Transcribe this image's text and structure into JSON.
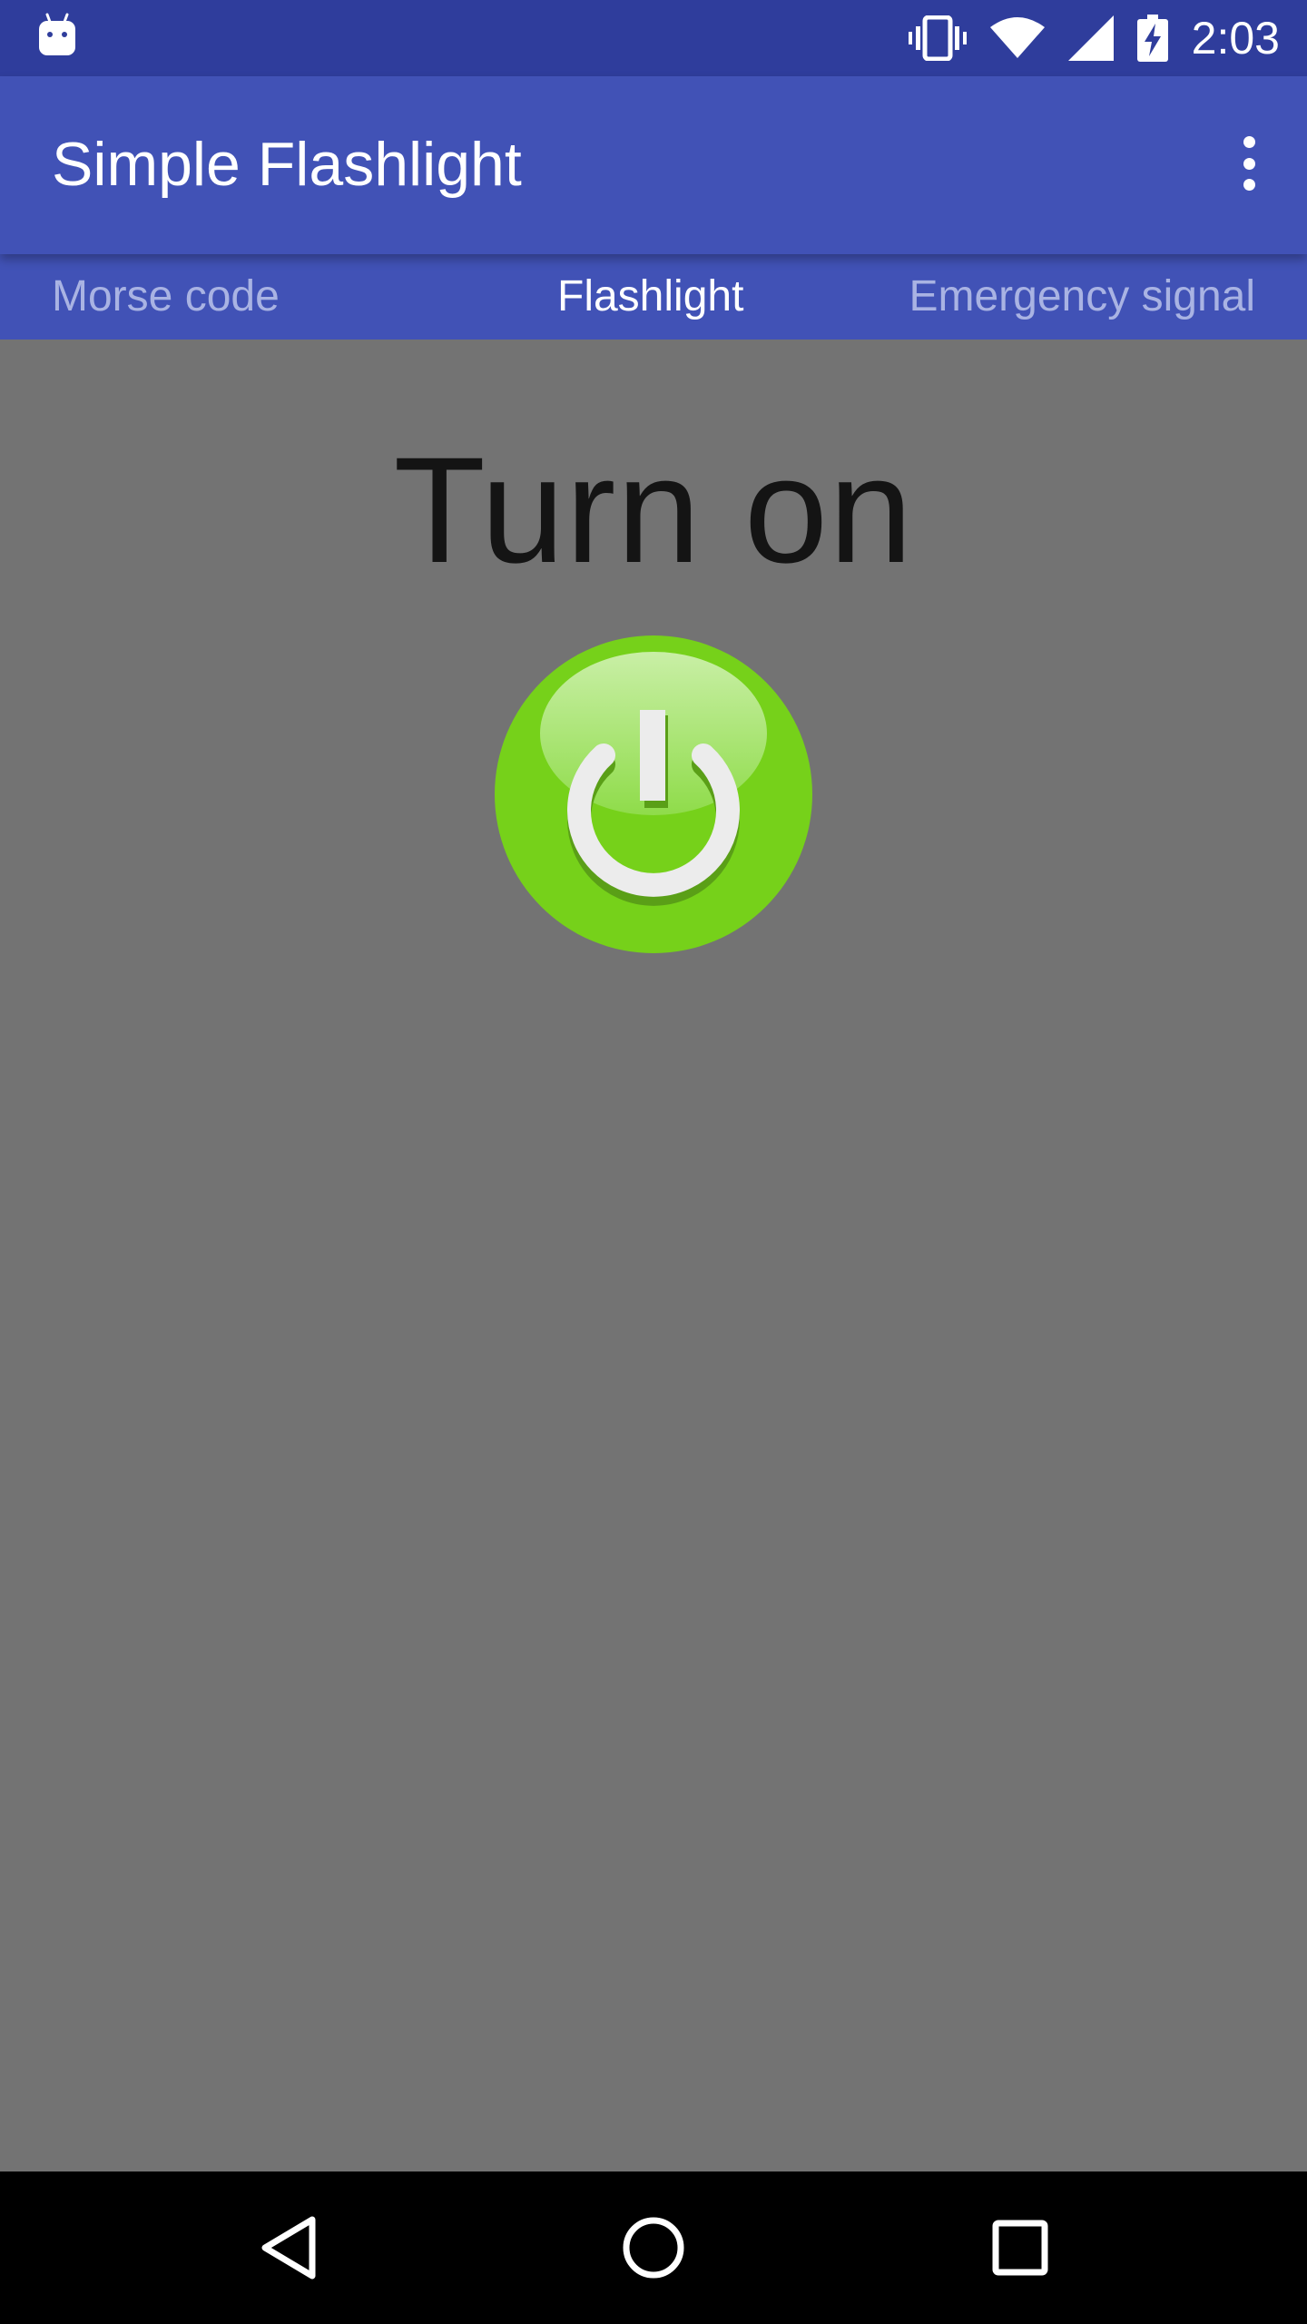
{
  "status_bar": {
    "time": "2:03",
    "icons": [
      "android-notification-icon",
      "vibrate-icon",
      "wifi-icon",
      "cell-signal-icon",
      "battery-charging-icon"
    ]
  },
  "app_bar": {
    "title": "Simple Flashlight",
    "menu_icon": "overflow-menu-icon"
  },
  "tabs": [
    {
      "label": "Morse code",
      "active": false
    },
    {
      "label": "Flashlight",
      "active": true
    },
    {
      "label": "Emergency signal",
      "active": false
    }
  ],
  "main": {
    "headline": "Turn on",
    "power_button_icon": "power-icon",
    "power_button_color": "#76d11a"
  },
  "nav_bar": {
    "icons": [
      "back-icon",
      "home-icon",
      "recent-apps-icon"
    ]
  },
  "colors": {
    "status_bar": "#2f3d9c",
    "primary": "#4152b6",
    "background": "#737373",
    "tab_inactive": "#a9b3e3"
  }
}
